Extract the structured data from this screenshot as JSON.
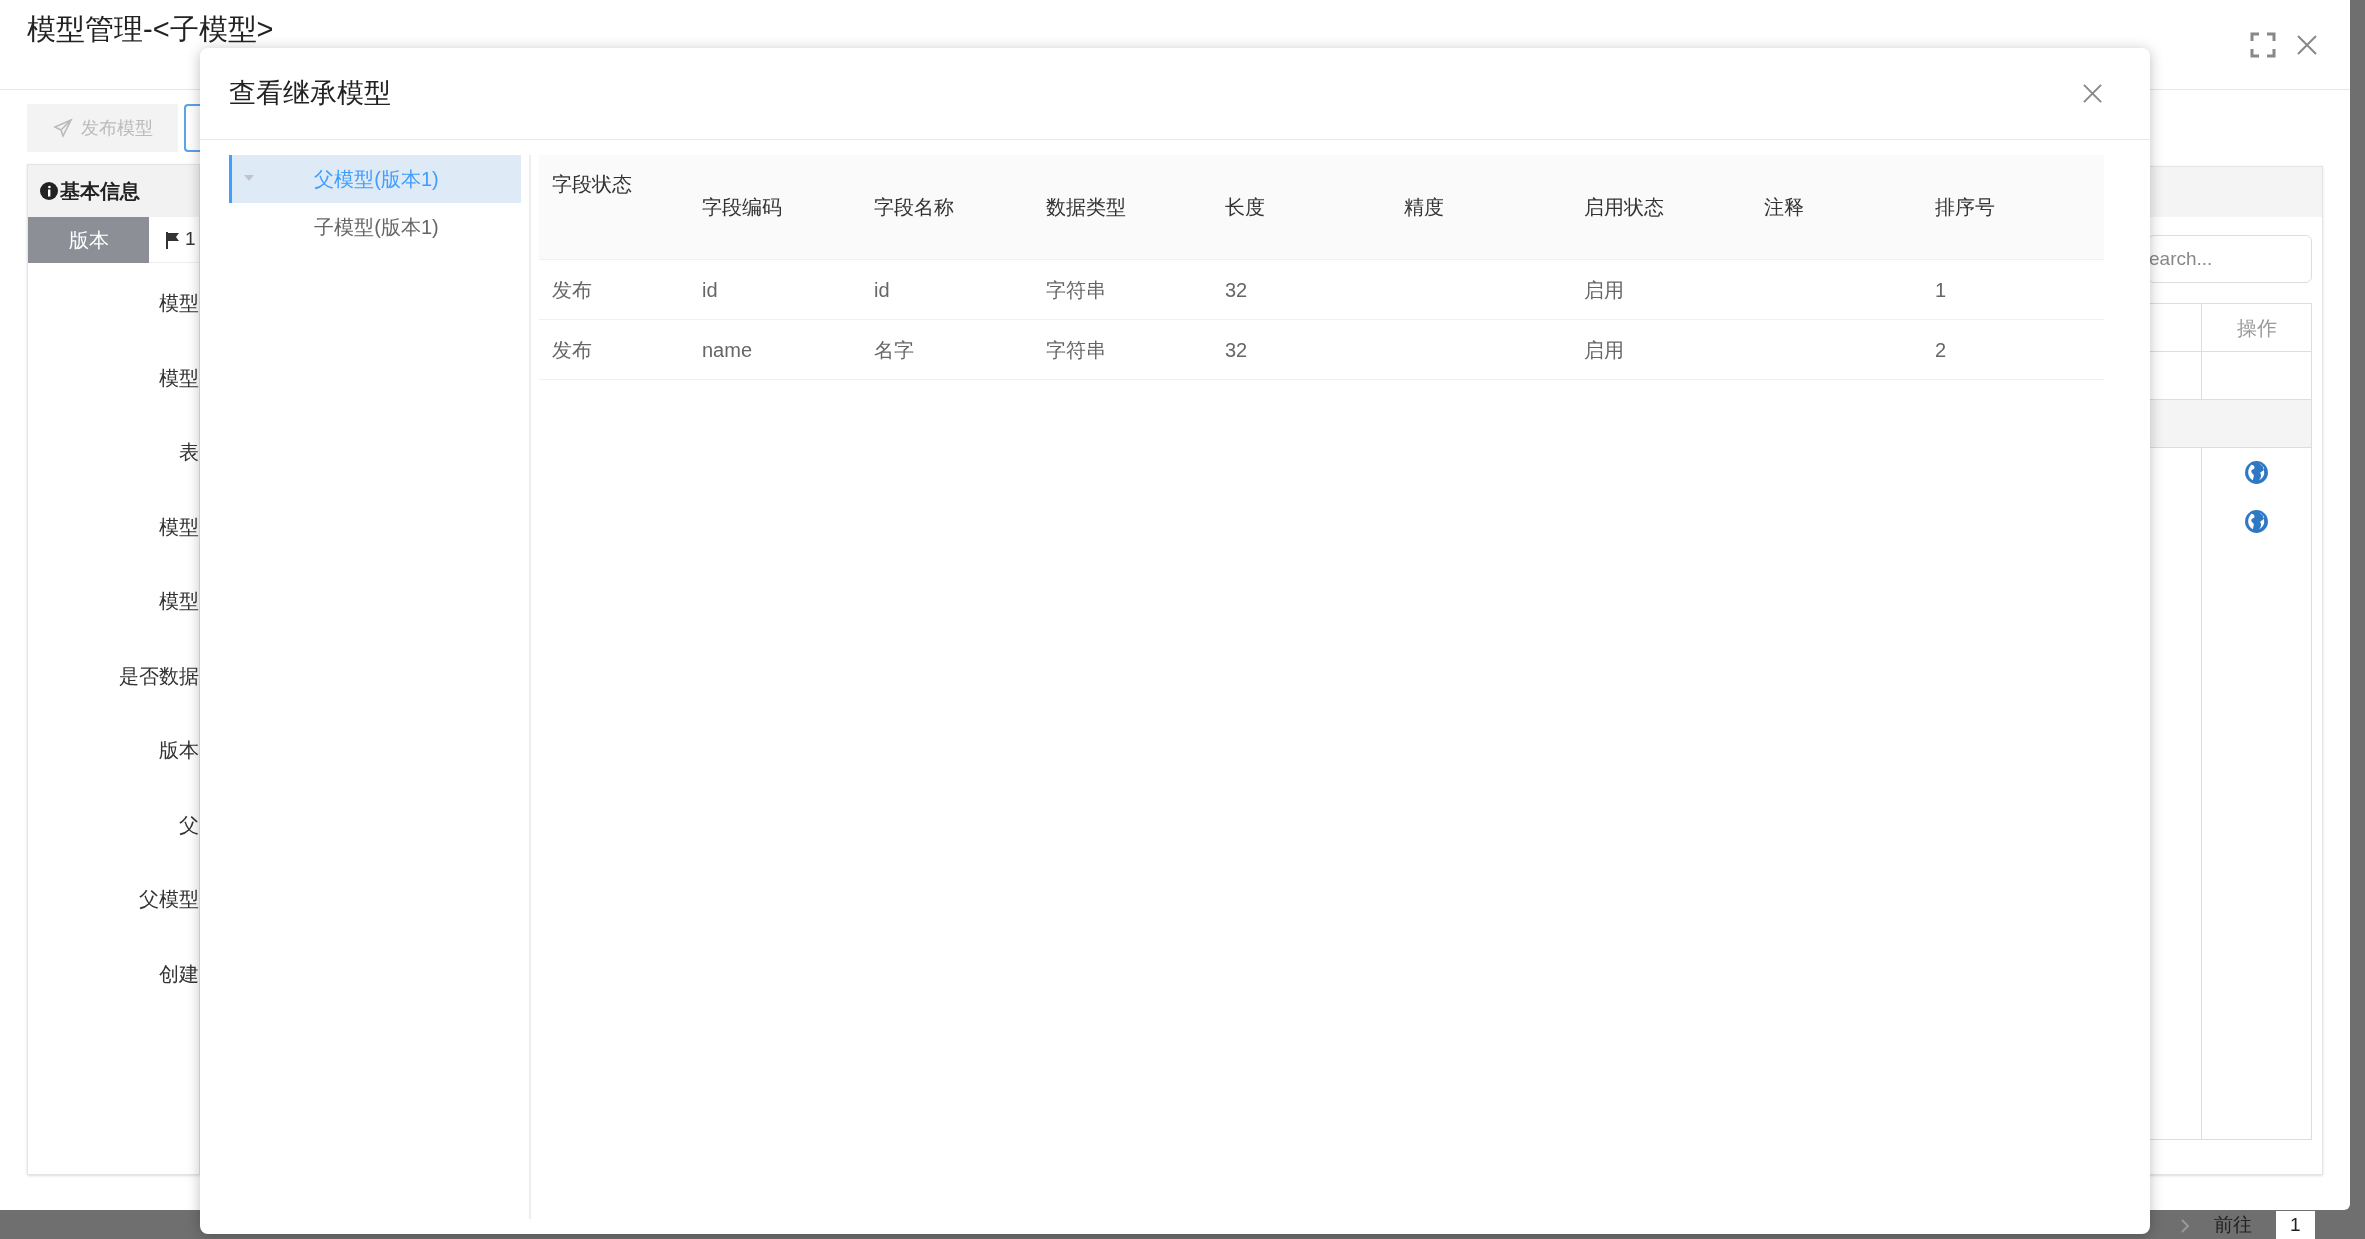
{
  "window": {
    "title": "模型管理-<子模型>"
  },
  "toolbar": {
    "publish_button": {
      "label": "发布模型",
      "disabled": true
    }
  },
  "basic_info": {
    "title": "基本信息",
    "tab": {
      "label": "版本",
      "selected": true
    },
    "version_tag": "1",
    "labels": [
      "模型",
      "模型",
      "表",
      "模型",
      "模型",
      "是否数据",
      "版本",
      "父",
      "父模型",
      "创建"
    ]
  },
  "right_panel": {
    "search": {
      "placeholder": "earch..."
    },
    "column": "操作",
    "rows": [
      {
        "kind": "empty"
      },
      {
        "kind": "group"
      },
      {
        "kind": "globe"
      },
      {
        "kind": "globe"
      }
    ]
  },
  "pagination": {
    "goto": "前往",
    "page": "1"
  },
  "dialog": {
    "title": "查看继承模型",
    "tree": [
      {
        "label": "父模型(版本1)",
        "selected": true,
        "expanded": true,
        "children": [
          {
            "label": "子模型(版本1)",
            "selected": false
          }
        ]
      }
    ],
    "table": {
      "columns": [
        "字段状态",
        "字段编码",
        "字段名称",
        "数据类型",
        "长度",
        "精度",
        "启用状态",
        "注释",
        "排序号"
      ],
      "rows": [
        [
          "发布",
          "id",
          "id",
          "字符串",
          "32",
          "",
          "启用",
          "",
          "1"
        ],
        [
          "发布",
          "name",
          "名字",
          "字符串",
          "32",
          "",
          "启用",
          "",
          "2"
        ]
      ]
    }
  }
}
